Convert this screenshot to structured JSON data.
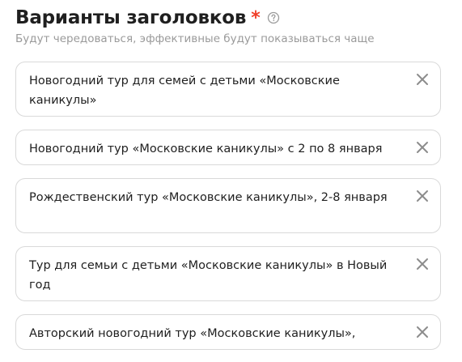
{
  "section": {
    "title": "Варианты заголовков",
    "required_mark": "*",
    "subtitle": "Будут чередоваться, эффективные будут показываться чаще"
  },
  "headlines": [
    {
      "value": "Новогодний тур для семей с детьми «Московские каникулы»"
    },
    {
      "value": "Новогодний тур «Московские каникулы» с 2 по 8 января"
    },
    {
      "value": "Рождественский тур «Московские каникулы», 2-8 января"
    },
    {
      "value": "Тур для семьи с детьми «Московские каникулы» в Новый год"
    },
    {
      "value": "Авторский новогодний тур «Московские каникулы»,"
    }
  ],
  "icons": {
    "help": "question-circle-icon",
    "clear": "close-icon"
  },
  "colors": {
    "required": "#f03e28",
    "subtitle": "#9a9a9a",
    "border": "#d9d9d9",
    "icon": "#8c8c8c"
  }
}
